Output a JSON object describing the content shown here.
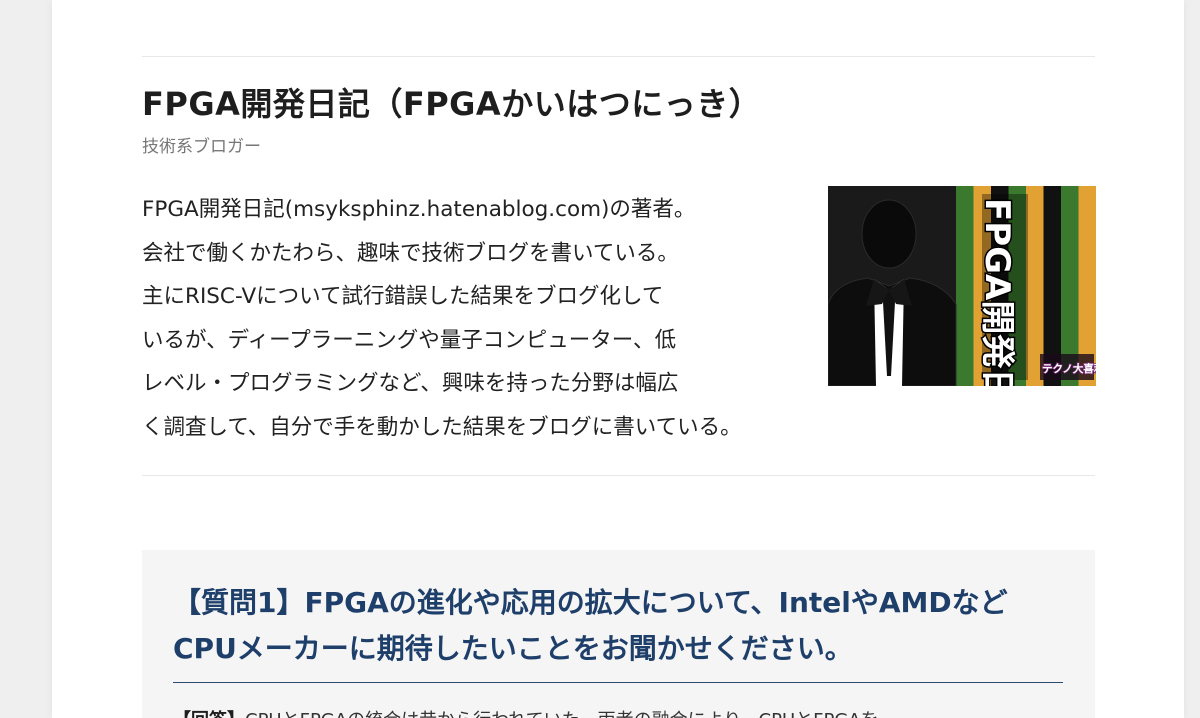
{
  "author": {
    "name": "FPGA開発日記（FPGAかいはつにっき）",
    "role": "技術系ブロガー",
    "bio_lines": [
      "FPGA開発日記(msyksphinz.hatenablog.com)の著者。",
      "会社で働くかたわら、趣味で技術ブログを書いている。",
      "主にRISC-Vについて試行錯誤した結果をブログ化して",
      "いるが、ディープラーニングや量子コンピューター、低",
      "レベル・プログラミングなど、興味を持った分野は幅広",
      "く調査して、自分で手を動かした結果をブログに書いている。"
    ],
    "avatar": {
      "icon": "businessman-silhouette-icon",
      "vertical_title": "FPGA開発日記",
      "badge": "テクノ大喜利",
      "stripe_colors": [
        "#3b7a2e",
        "#e2a233",
        "#111111",
        "#3b7a2e",
        "#e2a233",
        "#111111",
        "#3b7a2e",
        "#e2a233"
      ]
    }
  },
  "qa": {
    "question_lines": [
      "【質問1】FPGAの進化や応用の拡大について、IntelやAMDなど",
      "CPUメーカーに期待したいことをお聞かせください。"
    ],
    "answer_label": "【回答】",
    "answer_preview": "CPUとFPGAの統合は昔から行われていた。両者の融合により、CPUとFPGAを"
  }
}
